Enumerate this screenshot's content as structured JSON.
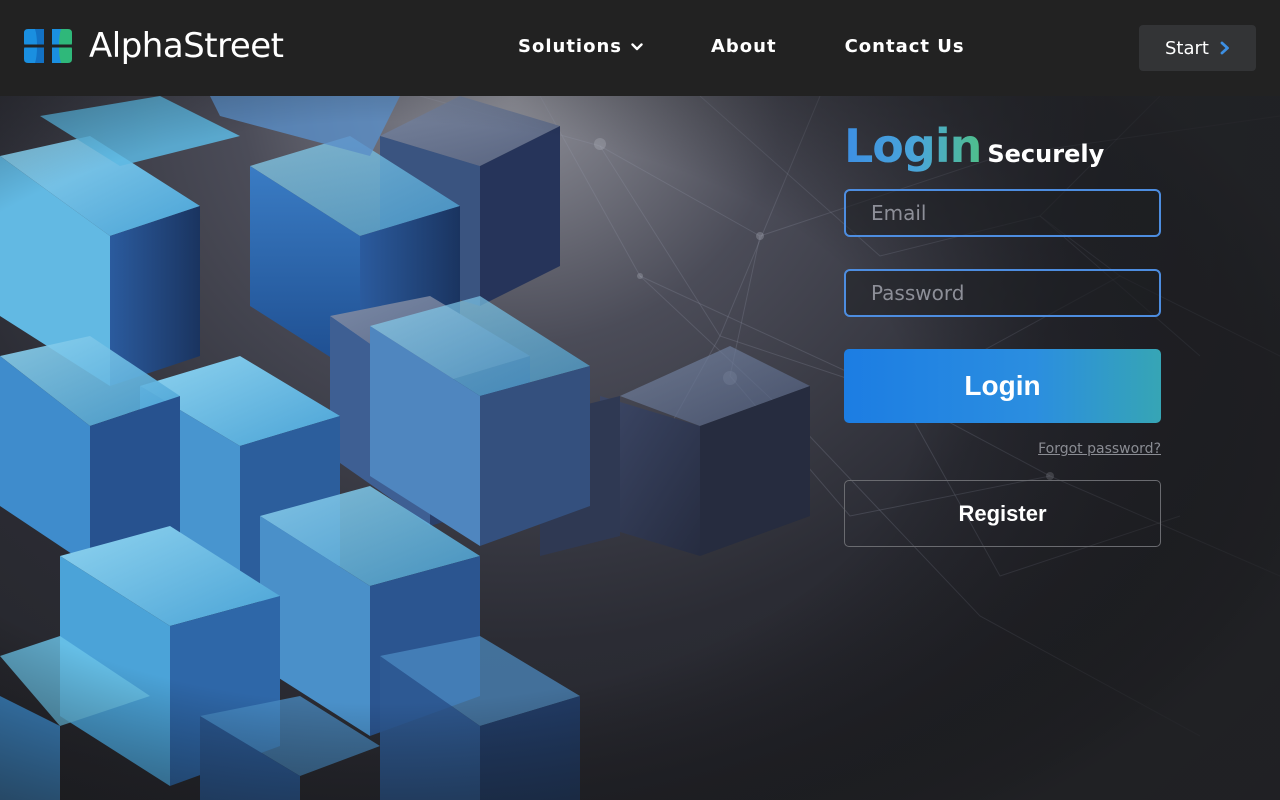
{
  "brand": {
    "name": "AlphaStreet",
    "logo_colors": [
      "#1a8fe0",
      "#2fb87a"
    ]
  },
  "nav": {
    "items": [
      {
        "label": "Solutions",
        "has_dropdown": true
      },
      {
        "label": "About"
      },
      {
        "label": "Contact Us"
      }
    ],
    "start_label": "Start",
    "start_icon": "chevron-right-icon"
  },
  "login": {
    "title": "Login",
    "subtitle": "Securely",
    "email_placeholder": "Email",
    "password_placeholder": "Password",
    "submit_label": "Login",
    "forgot_label": "Forgot password?",
    "register_label": "Register"
  },
  "colors": {
    "accent_blue": "#3d8fe3",
    "accent_green": "#4fbf8a",
    "topbar": "#222222"
  }
}
